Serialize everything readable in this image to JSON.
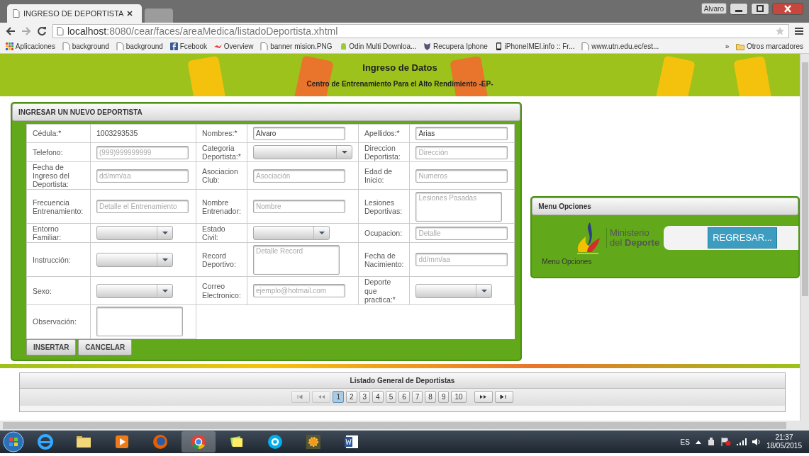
{
  "browser": {
    "tab_title": "INGRESO DE DEPORTISTA",
    "user": "Alvaro",
    "url_host": "localhost",
    "url_path": ":8080/cear/faces/areaMedica/listadoDeportista.xhtml",
    "bookmarks": [
      {
        "kind": "apps",
        "label": "Aplicaciones"
      },
      {
        "kind": "page",
        "label": "background"
      },
      {
        "kind": "page",
        "label": "background"
      },
      {
        "kind": "facebook",
        "label": "Fcebook"
      },
      {
        "kind": "overview",
        "label": "Overview"
      },
      {
        "kind": "page",
        "label": "banner mision.PNG"
      },
      {
        "kind": "android",
        "label": "Odin Multi Downloa..."
      },
      {
        "kind": "shield",
        "label": "Recupera Iphone"
      },
      {
        "kind": "phone",
        "label": "iPhoneIMEI.info :: Fr..."
      },
      {
        "kind": "page",
        "label": "www.utn.edu.ec/est..."
      }
    ],
    "more": "»",
    "other_bookmarks": "Otros marcadores"
  },
  "header": {
    "title": "Ingreso de Datos",
    "subtitle": "Centro de Entrenamiento Para el Alto Rendimiento -EP-"
  },
  "form": {
    "title": "INGRESAR UN NUEVO DEPORTISTA",
    "rows": [
      [
        {
          "label": "Cédula:*",
          "kind": "static",
          "value": "1003293535"
        },
        {
          "label": "Nombres:*",
          "kind": "text",
          "value": "Alvaro"
        },
        {
          "label": "Apellidos:*",
          "kind": "text",
          "value": "Arias"
        }
      ],
      [
        {
          "label": "Telefono:",
          "kind": "text",
          "placeholder": "(999)999999999"
        },
        {
          "label": "Categoria Deportista:*",
          "kind": "select"
        },
        {
          "label": "Direccion Deportista:",
          "kind": "text",
          "placeholder": "Dirección"
        }
      ],
      [
        {
          "label": "Fecha de Ingreso del Deportista:",
          "kind": "text",
          "placeholder": "dd/mm/aa"
        },
        {
          "label": "Asociacion Club:",
          "kind": "text",
          "placeholder": "Asociación"
        },
        {
          "label": "Edad de Inicio:",
          "kind": "text",
          "placeholder": "Numeros"
        }
      ],
      [
        {
          "label": "Frecuencia Entrenamiento:",
          "kind": "text",
          "placeholder": "Detalle el Entrenamiento"
        },
        {
          "label": "Nombre Entrenador:",
          "kind": "text",
          "placeholder": "Nombre"
        },
        {
          "label": "Lesiones Deportivas:",
          "kind": "textarea",
          "placeholder": "Lesiones Pasadas"
        }
      ],
      [
        {
          "label": "Entorno Familiar:",
          "kind": "select"
        },
        {
          "label": "Estado Civil:",
          "kind": "select"
        },
        {
          "label": "Ocupacion:",
          "kind": "text",
          "placeholder": "Detalle"
        }
      ],
      [
        {
          "label": "Instrucción:",
          "kind": "select"
        },
        {
          "label": "Record Deportivo:",
          "kind": "textarea",
          "placeholder": "Detalle Record"
        },
        {
          "label": "Fecha de Nacimiento:",
          "kind": "text",
          "placeholder": "dd/mm/aa"
        }
      ],
      [
        {
          "label": "Sexo:",
          "kind": "select"
        },
        {
          "label": "Correo Electronico:",
          "kind": "text",
          "placeholder": "ejemplo@hotmail.com"
        },
        {
          "label": "Deporte que practica:*",
          "kind": "select"
        }
      ],
      [
        {
          "label": "Observación:",
          "kind": "textarea"
        }
      ]
    ],
    "buttons": [
      "INSERTAR",
      "CANCELAR"
    ]
  },
  "menu": {
    "title": "Menu Opciones",
    "logo_line1": "Ministerio",
    "logo_line2": "del **Deporte**",
    "button": "REGRESAR...",
    "footer": "Menu Opciones"
  },
  "listing": {
    "title": "Listado General de Deportistas",
    "pager": [
      {
        "kind": "first",
        "disabled": true
      },
      {
        "kind": "prev",
        "disabled": true
      },
      {
        "kind": "page",
        "label": "1",
        "selected": true
      },
      {
        "kind": "page",
        "label": "2",
        "selected": false
      },
      {
        "kind": "page",
        "label": "3",
        "selected": false
      },
      {
        "kind": "page",
        "label": "4",
        "selected": false
      },
      {
        "kind": "page",
        "label": "5",
        "selected": false
      },
      {
        "kind": "page",
        "label": "6",
        "selected": false
      },
      {
        "kind": "page",
        "label": "7",
        "selected": false
      },
      {
        "kind": "page",
        "label": "8",
        "selected": false
      },
      {
        "kind": "page",
        "label": "9",
        "selected": false
      },
      {
        "kind": "page",
        "label": "10",
        "selected": false
      },
      {
        "kind": "next",
        "disabled": false
      },
      {
        "kind": "last",
        "disabled": false
      }
    ]
  },
  "taskbar": {
    "language": "ES",
    "time": "21:37",
    "date": "18/05/2015"
  }
}
